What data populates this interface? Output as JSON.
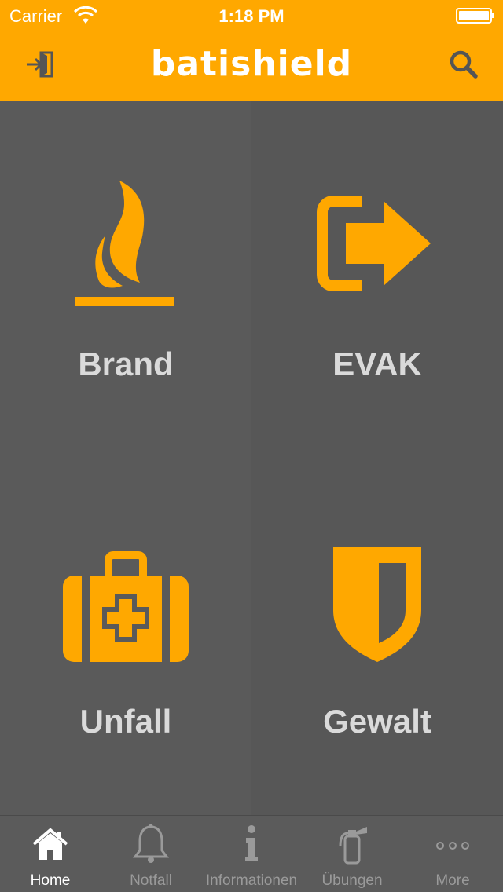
{
  "status_bar": {
    "carrier": "Carrier",
    "time": "1:18 PM"
  },
  "header": {
    "title": "batishield",
    "exit_icon": "exit-door-icon",
    "search_icon": "search-icon"
  },
  "tiles": [
    {
      "label": "Brand",
      "icon": "flame-icon"
    },
    {
      "label": "EVAK",
      "icon": "evacuation-exit-icon"
    },
    {
      "label": "Unfall",
      "icon": "first-aid-kit-icon"
    },
    {
      "label": "Gewalt",
      "icon": "shield-icon"
    }
  ],
  "tabbar": {
    "items": [
      {
        "label": "Home",
        "icon": "home-icon",
        "active": true
      },
      {
        "label": "Notfall",
        "icon": "bell-icon",
        "active": false
      },
      {
        "label": "Informationen",
        "icon": "info-icon",
        "active": false
      },
      {
        "label": "Übungen",
        "icon": "fire-extinguisher-icon",
        "active": false
      },
      {
        "label": "More",
        "icon": "more-dots-icon",
        "active": false
      }
    ]
  },
  "colors": {
    "accent": "#FFA800",
    "tile_bg": "#5A5A5A",
    "tile_label": "#DADADA",
    "tab_active": "#FFFFFF",
    "tab_inactive": "#9A9A9A"
  }
}
